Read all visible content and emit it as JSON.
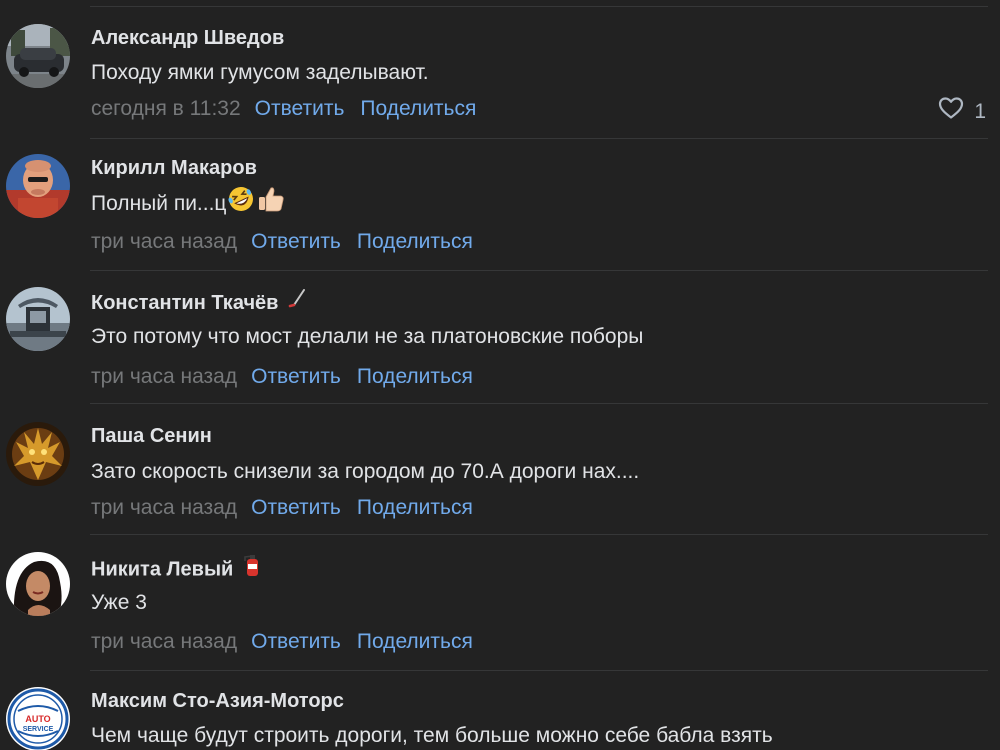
{
  "comments": [
    {
      "author": "Александр Шведов",
      "text": "Походу ямки гумусом заделывают.",
      "time": "сегодня в 11:32",
      "reply": "Ответить",
      "share": "Поделиться",
      "likes": "1"
    },
    {
      "author": "Кирилл Макаров",
      "text": "Полный пи...ц",
      "emoji": [
        "rolling-on-floor-laughing-emoji",
        "thumbs-up-emoji"
      ],
      "time": "три часа назад",
      "reply": "Ответить",
      "share": "Поделиться"
    },
    {
      "author": "Константин Ткачёв",
      "badge": "hockey-stick-badge",
      "text": "Это потому что мост делали не за платоновские поборы",
      "time": "три часа назад",
      "reply": "Ответить",
      "share": "Поделиться"
    },
    {
      "author": "Паша Сенин",
      "text": "Зато скорость снизели за городом до 70.А дороги нах....",
      "time": "три часа назад",
      "reply": "Ответить",
      "share": "Поделиться"
    },
    {
      "author": "Никита Левый",
      "badge": "fire-extinguisher-badge",
      "text": "Уже 3",
      "time": "три часа назад",
      "reply": "Ответить",
      "share": "Поделиться"
    },
    {
      "author": "Максим Сто-Азия-Моторс",
      "text": "Чем чаще будут строить дороги, тем больше можно себе бабла взять",
      "avatar_text": [
        "AUTO",
        "SERVICE"
      ]
    }
  ],
  "colors": {
    "background": "#222222",
    "text": "#e1e3e6",
    "secondary": "#76787a",
    "link": "#71aaeb",
    "divider": "#363738"
  }
}
